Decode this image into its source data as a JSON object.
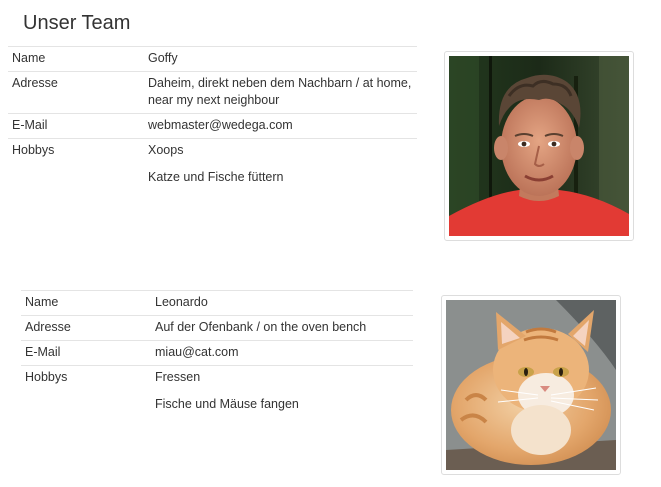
{
  "page": {
    "title": "Unser Team"
  },
  "members": [
    {
      "fields": [
        {
          "label": "Name",
          "value": "Goffy"
        },
        {
          "label": "Adresse",
          "value": "Daheim, direkt neben dem Nachbarn / at home, near my next neighbour"
        },
        {
          "label": "E-Mail",
          "value": "webmaster@wedega.com"
        },
        {
          "label": "Hobbys",
          "value": "Xoops"
        }
      ],
      "extra": "Katze und Fische füttern",
      "photo_subject": "man-portrait"
    },
    {
      "fields": [
        {
          "label": "Name",
          "value": "Leonardo"
        },
        {
          "label": "Adresse",
          "value": "Auf der Ofenbank / on the oven bench"
        },
        {
          "label": "E-Mail",
          "value": "miau@cat.com"
        },
        {
          "label": "Hobbys",
          "value": "Fressen"
        }
      ],
      "extra": "Fische und Mäuse fangen",
      "photo_subject": "orange-cat"
    }
  ]
}
